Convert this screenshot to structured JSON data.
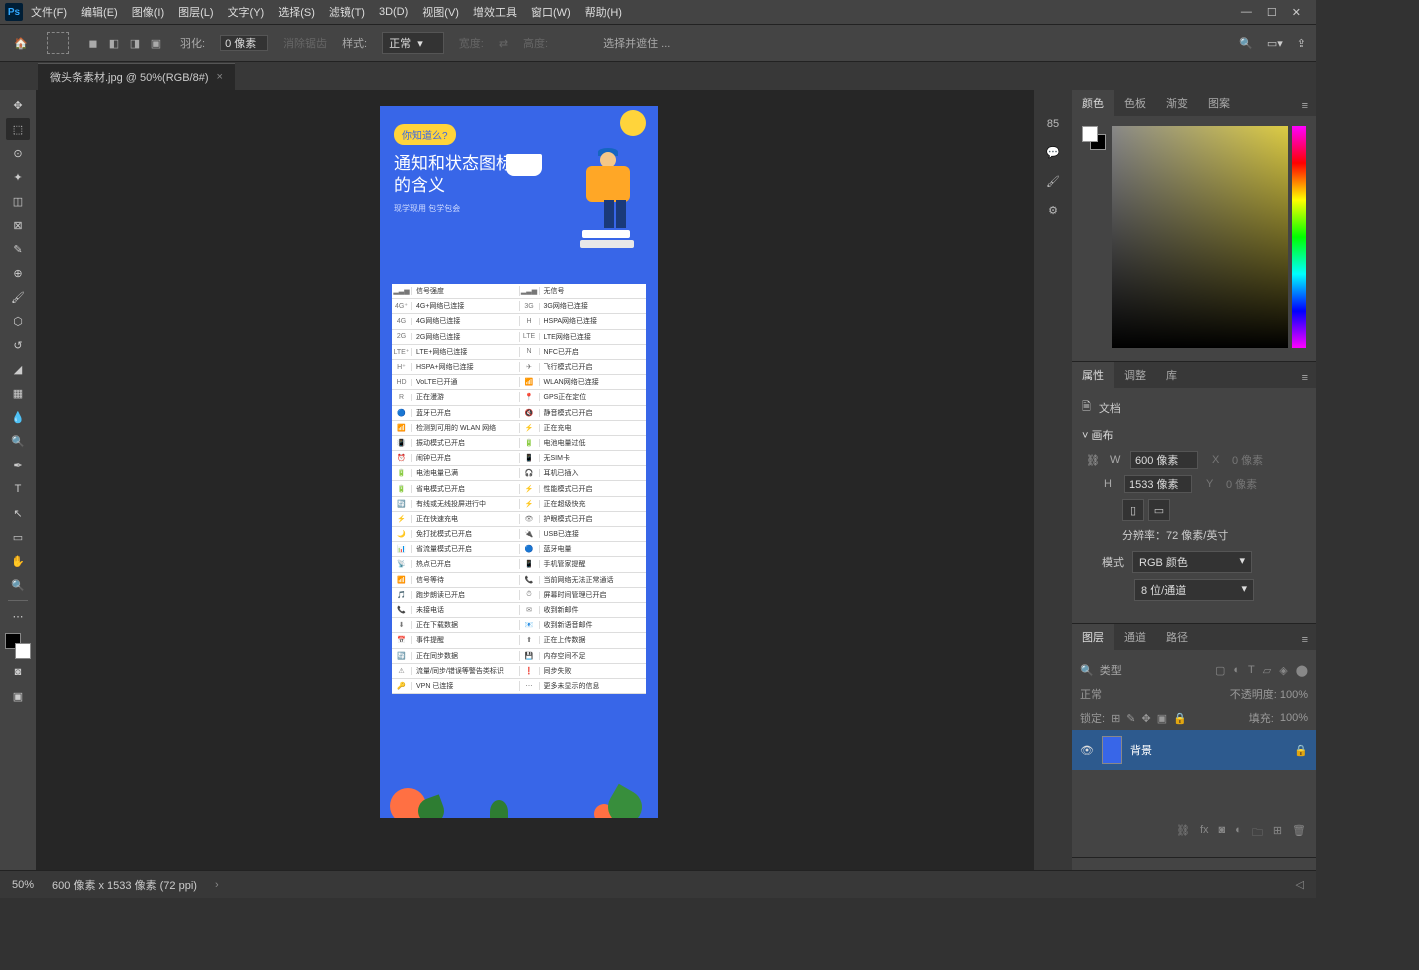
{
  "menubar": {
    "items": [
      "文件(F)",
      "编辑(E)",
      "图像(I)",
      "图层(L)",
      "文字(Y)",
      "选择(S)",
      "滤镜(T)",
      "3D(D)",
      "视图(V)",
      "增效工具",
      "窗口(W)",
      "帮助(H)"
    ]
  },
  "optbar": {
    "feather_label": "羽化:",
    "feather_value": "0 像素",
    "antialias": "消除锯齿",
    "style_label": "样式:",
    "style_value": "正常",
    "width_label": "宽度:",
    "height_label": "高度:",
    "select_mask": "选择并遮住 ..."
  },
  "tab": {
    "name": "微头条素材.jpg @ 50%(RGB/8#)"
  },
  "canvas_doc": {
    "badge": "你知道么?",
    "title_l1": "通知和状态图标",
    "title_l2": "的含义",
    "sub": "现学现用 包学包会",
    "rows": [
      {
        "i1": "▂▃▅",
        "t1": "信号强度",
        "i2": "▂▃▅",
        "t2": "无信号"
      },
      {
        "i1": "4G⁺",
        "t1": "4G+网络已连接",
        "i2": "3G",
        "t2": "3G网络已连接"
      },
      {
        "i1": "4G",
        "t1": "4G网络已连接",
        "i2": "H",
        "t2": "HSPA网络已连接"
      },
      {
        "i1": "2G",
        "t1": "2G网络已连接",
        "i2": "LTE",
        "t2": "LTE网络已连接"
      },
      {
        "i1": "LTE⁺",
        "t1": "LTE+网络已连接",
        "i2": "N",
        "t2": "NFC已开启"
      },
      {
        "i1": "H⁺",
        "t1": "HSPA+网络已连接",
        "i2": "✈",
        "t2": "飞行模式已开启"
      },
      {
        "i1": "HD",
        "t1": "VoLTE已开通",
        "i2": "📶",
        "t2": "WLAN网络已连接"
      },
      {
        "i1": "R",
        "t1": "正在漫游",
        "i2": "📍",
        "t2": "GPS正在定位"
      },
      {
        "i1": "🔵",
        "t1": "蓝牙已开启",
        "i2": "🔇",
        "t2": "静音模式已开启"
      },
      {
        "i1": "📶",
        "t1": "检测到可用的 WLAN 网络",
        "i2": "⚡",
        "t2": "正在充电"
      },
      {
        "i1": "📳",
        "t1": "振动模式已开启",
        "i2": "🔋",
        "t2": "电池电量过低"
      },
      {
        "i1": "⏰",
        "t1": "闹钟已开启",
        "i2": "📱",
        "t2": "无SIM卡"
      },
      {
        "i1": "🔋",
        "t1": "电池电量已满",
        "i2": "🎧",
        "t2": "耳机已插入"
      },
      {
        "i1": "🔋",
        "t1": "省电模式已开启",
        "i2": "⚡",
        "t2": "性能模式已开启"
      },
      {
        "i1": "🔄",
        "t1": "有线或无线投屏进行中",
        "i2": "⚡",
        "t2": "正在超级快充"
      },
      {
        "i1": "⚡",
        "t1": "正在快速充电",
        "i2": "👁",
        "t2": "护眼模式已开启"
      },
      {
        "i1": "🌙",
        "t1": "免打扰模式已开启",
        "i2": "🔌",
        "t2": "USB已连接"
      },
      {
        "i1": "📊",
        "t1": "省流量模式已开启",
        "i2": "🔵",
        "t2": "蓝牙电量"
      },
      {
        "i1": "📡",
        "t1": "热点已开启",
        "i2": "📱",
        "t2": "手机管家提醒"
      },
      {
        "i1": "📶",
        "t1": "信号等待",
        "i2": "📞",
        "t2": "当前网络无法正常通话"
      },
      {
        "i1": "🎵",
        "t1": "跑步朗读已开启",
        "i2": "⏱",
        "t2": "屏幕时间管理已开启"
      },
      {
        "i1": "📞",
        "t1": "未接电话",
        "i2": "✉",
        "t2": "收到新邮件"
      },
      {
        "i1": "⬇",
        "t1": "正在下载数据",
        "i2": "📧",
        "t2": "收到新语音邮件"
      },
      {
        "i1": "📅",
        "t1": "事件提醒",
        "i2": "⬆",
        "t2": "正在上传数据"
      },
      {
        "i1": "🔄",
        "t1": "正在同步数据",
        "i2": "💾",
        "t2": "内存空间不足"
      },
      {
        "i1": "⚠",
        "t1": "流量/同步/错误等警告类标识",
        "i2": "❗",
        "t2": "同步失败"
      },
      {
        "i1": "🔑",
        "t1": "VPN 已连接",
        "i2": "⋯",
        "t2": "更多未显示的信息"
      }
    ]
  },
  "panels": {
    "color": {
      "tabs": [
        "颜色",
        "色板",
        "渐变",
        "图案"
      ]
    },
    "props": {
      "tabs": [
        "属性",
        "调整",
        "库"
      ],
      "doc": "文档",
      "section": "画布",
      "w": "W",
      "w_val": "600 像素",
      "h": "H",
      "h_val": "1533 像素",
      "x": "X",
      "x_val": "0 像素",
      "y": "Y",
      "y_val": "0 像素",
      "res": "分辨率：72 像素/英寸",
      "mode_lbl": "模式",
      "mode_val": "RGB 颜色",
      "bit_val": "8 位/通道"
    },
    "layers": {
      "tabs": [
        "图层",
        "通道",
        "路径"
      ],
      "type": "类型",
      "blend": "正常",
      "opacity_lbl": "不透明度:",
      "opacity_val": "100%",
      "lock_lbl": "锁定:",
      "fill_lbl": "填充:",
      "fill_val": "100%",
      "layer_name": "背景"
    }
  },
  "status": {
    "zoom": "50%",
    "dims": "600 像素 x 1533 像素 (72 ppi)"
  }
}
